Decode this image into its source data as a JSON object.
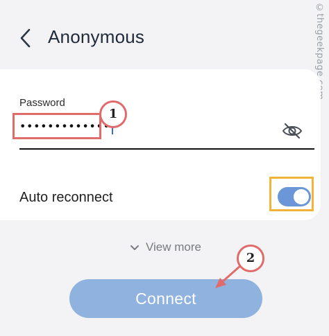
{
  "header": {
    "title": "Anonymous",
    "back_icon": "chevron-left-icon"
  },
  "watermark": "©thegeekpage.com",
  "password": {
    "label": "Password",
    "value": "•••••••••••••",
    "visibility_icon": "eye-off-icon"
  },
  "auto_reconnect": {
    "label": "Auto reconnect",
    "enabled": true
  },
  "view_more": {
    "label": "View more",
    "icon": "chevron-down-icon"
  },
  "connect": {
    "label": "Connect"
  },
  "annotations": {
    "badge_1": "1",
    "badge_2": "2"
  },
  "colors": {
    "accent": "#6b96d8",
    "button": "#8fb2de",
    "annotation_red": "#e06b6b",
    "annotation_yellow": "#f0b43a"
  }
}
